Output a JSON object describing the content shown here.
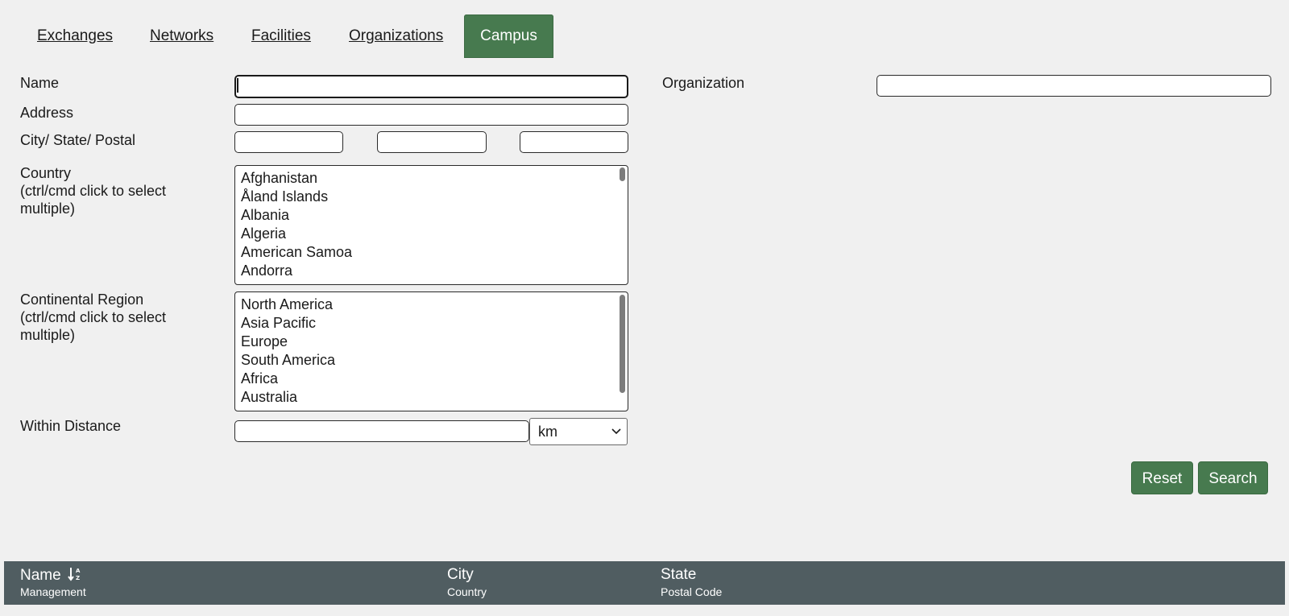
{
  "tabs": [
    {
      "label": "Exchanges",
      "active": false
    },
    {
      "label": "Networks",
      "active": false
    },
    {
      "label": "Facilities",
      "active": false
    },
    {
      "label": "Organizations",
      "active": false
    },
    {
      "label": "Campus",
      "active": true
    }
  ],
  "form": {
    "name_label": "Name",
    "name_value": "",
    "address_label": "Address",
    "address_value": "",
    "city_state_postal_label": "City/ State/ Postal",
    "city_value": "",
    "state_value": "",
    "postal_value": "",
    "country_label_line1": "Country",
    "country_label_line2": "(ctrl/cmd click to select",
    "country_label_line3": "multiple)",
    "countries": [
      "Afghanistan",
      "Åland Islands",
      "Albania",
      "Algeria",
      "American Samoa",
      "Andorra"
    ],
    "region_label_line1": "Continental Region",
    "region_label_line2": "(ctrl/cmd click to select",
    "region_label_line3": "multiple)",
    "regions": [
      "North America",
      "Asia Pacific",
      "Europe",
      "South America",
      "Africa",
      "Australia"
    ],
    "distance_label": "Within Distance",
    "distance_value": "",
    "distance_unit": "km",
    "organization_label": "Organization",
    "organization_value": ""
  },
  "buttons": {
    "reset_label": "Reset",
    "search_label": "Search"
  },
  "colors": {
    "accent": "#477a4f",
    "header_bg": "#505d61",
    "page_bg": "#f0f0f0"
  },
  "results_header": {
    "name": "Name",
    "management": "Management",
    "city": "City",
    "country": "Country",
    "state": "State",
    "postal_code": "Postal Code",
    "sort_icon": "sort-alpha-down-icon"
  }
}
